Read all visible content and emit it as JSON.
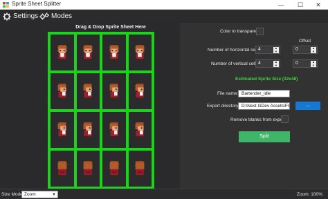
{
  "window": {
    "title": "Sprite Sheet Splitter",
    "minimize": "—",
    "maximize": "☐",
    "close": "✕"
  },
  "menu": {
    "settings": "Settings",
    "modes": "Modes"
  },
  "drop_zone": {
    "title": "Drag & Drop Sprite Sheet Here",
    "rows": 4,
    "cols": 4
  },
  "sprites": [
    "front",
    "front",
    "front",
    "front",
    "side",
    "side",
    "side",
    "side",
    "side",
    "side",
    "side",
    "side",
    "back",
    "back",
    "back",
    "back"
  ],
  "colors": {
    "grid": "#1bd31b",
    "estimate": "#3fd63f",
    "browse": "#1478d4",
    "split": "#3fb569"
  },
  "settings": {
    "color_to_transparent_label": "Color to transparent:",
    "offset_label": "Offset",
    "horizontal_label": "Number of horizontal cells:",
    "horizontal_value": "4",
    "horizontal_offset": "0",
    "vertical_label": "Number of vertical cells:",
    "vertical_value": "4",
    "vertical_offset": "0",
    "estimate_text": "Estimated Sprite Size (32x48)",
    "file_name_label": "File name:",
    "file_name_value": "Bartender_idle",
    "export_dir_label": "Export directory:",
    "export_dir_value": "D:\\Nest GDev Assets\\Fran",
    "browse_label": "...",
    "remove_blanks_label": "Remove blanks from export:",
    "split_label": "Split"
  },
  "status": {
    "size_mode_label": "Size Mode:",
    "size_mode_value": "Zoom",
    "zoom_text": "Zoom: 100%"
  }
}
